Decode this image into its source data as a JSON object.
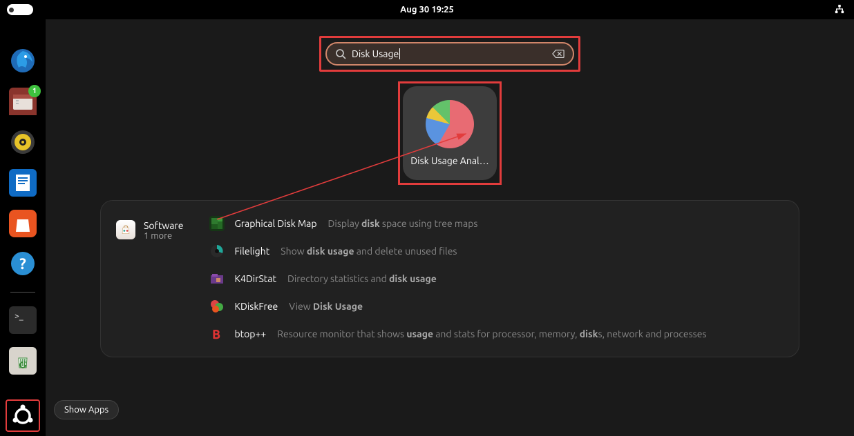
{
  "topbar": {
    "clock": "Aug 30  19:25"
  },
  "dock": {
    "items": [
      {
        "name": "thunderbird"
      },
      {
        "name": "files",
        "badge": "1"
      },
      {
        "name": "rhythmbox"
      },
      {
        "name": "libreoffice-writer"
      },
      {
        "name": "ubuntu-software"
      },
      {
        "name": "help"
      }
    ],
    "extra_items": [
      {
        "name": "terminal"
      },
      {
        "name": "trash"
      }
    ]
  },
  "search": {
    "query": "Disk Usage"
  },
  "result_tile": {
    "label": "Disk Usage Anal…"
  },
  "software_section": {
    "heading": "Software",
    "subheading": "1 more",
    "rows": [
      {
        "name": "Graphical Disk Map",
        "desc_pre": "Display ",
        "desc_b1": "disk",
        "desc_mid": " space using tree maps",
        "desc_b2": "",
        "desc_tail": ""
      },
      {
        "name": "Filelight",
        "desc_pre": "Show ",
        "desc_b1": "disk usage",
        "desc_mid": " and delete unused files",
        "desc_b2": "",
        "desc_tail": ""
      },
      {
        "name": "K4DirStat",
        "desc_pre": "Directory statistics and ",
        "desc_b1": "disk usage",
        "desc_mid": "",
        "desc_b2": "",
        "desc_tail": ""
      },
      {
        "name": "KDiskFree",
        "desc_pre": "View ",
        "desc_b1": "Disk Usage",
        "desc_mid": "",
        "desc_b2": "",
        "desc_tail": ""
      },
      {
        "name": "btop++",
        "desc_pre": "Resource monitor that shows ",
        "desc_b1": "usage",
        "desc_mid": " and stats for processor, memory, ",
        "desc_b2": "disk",
        "desc_tail": "s, network and processes"
      }
    ]
  },
  "tooltip": {
    "label": "Show Apps"
  }
}
